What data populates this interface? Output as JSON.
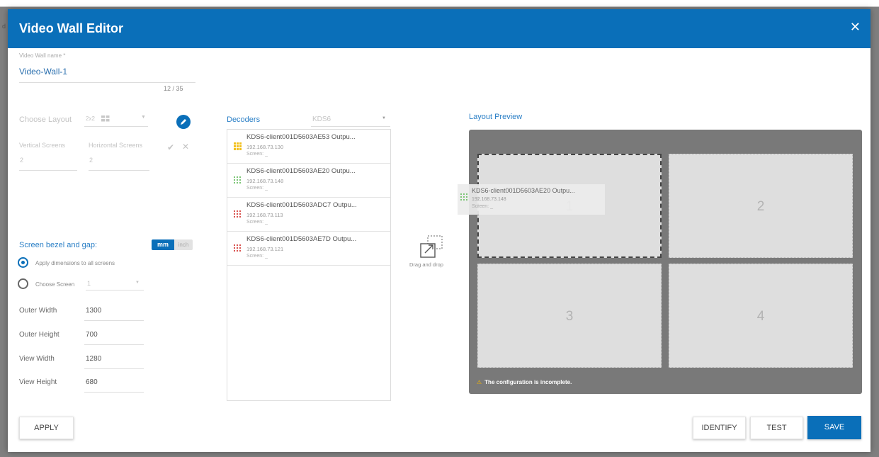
{
  "backdrop": {
    "edge_char": "d"
  },
  "dialog": {
    "title": "Video Wall Editor",
    "close_glyph": "✕"
  },
  "name_field": {
    "label": "Video Wall name *",
    "value": "Video-Wall-1",
    "counter": "12 / 35"
  },
  "layout": {
    "label": "Choose Layout",
    "value": "2x2",
    "vertical_label": "Vertical Screens",
    "vertical_value": "2",
    "horizontal_label": "Horizontal Screens",
    "horizontal_value": "2"
  },
  "bezel": {
    "title": "Screen bezel and gap:",
    "unit_mm": "mm",
    "unit_inch": "inch",
    "option_all": "Apply dimensions to all screens",
    "option_choose": "Choose Screen",
    "choose_value": "1",
    "selected_option": "all",
    "fields": [
      {
        "label": "Outer Width",
        "value": "1300"
      },
      {
        "label": "Outer Height",
        "value": "700"
      },
      {
        "label": "View Width",
        "value": "1280"
      },
      {
        "label": "View Height",
        "value": "680"
      }
    ]
  },
  "decoders": {
    "title": "Decoders",
    "filter_value": "KDS6",
    "items": [
      {
        "name": "KDS6-client001D5603AE53 Outpu...",
        "ip": "192.168.73.130",
        "screen": "Screen: _",
        "status": "yellow"
      },
      {
        "name": "KDS6-client001D5603AE20 Outpu...",
        "ip": "192.168.73.148",
        "screen": "Screen: _",
        "status": "green"
      },
      {
        "name": "KDS6-client001D5603ADC7 Outpu...",
        "ip": "192.168.73.113",
        "screen": "Screen: _",
        "status": "red"
      },
      {
        "name": "KDS6-client001D5603AE7D Outpu...",
        "ip": "192.168.73.121",
        "screen": "Screen: _",
        "status": "red"
      }
    ]
  },
  "drag_hint": {
    "label": "Drag and drop"
  },
  "preview": {
    "title": "Layout Preview",
    "screens": [
      "1",
      "2",
      "3",
      "4"
    ],
    "dragging": {
      "name": "KDS6-client001D5603AE20 Outpu...",
      "ip": "192.168.73.148",
      "screen": "Screen: _"
    },
    "warning": "The configuration is incomplete."
  },
  "actions": {
    "apply": "APPLY",
    "identify": "IDENTIFY",
    "test": "TEST",
    "save": "SAVE"
  },
  "colors": {
    "primary": "#0a6fb9",
    "status_yellow": "#f2c01d",
    "status_green": "#7cc576",
    "status_red": "#d9534f",
    "warning": "#f2b400"
  }
}
